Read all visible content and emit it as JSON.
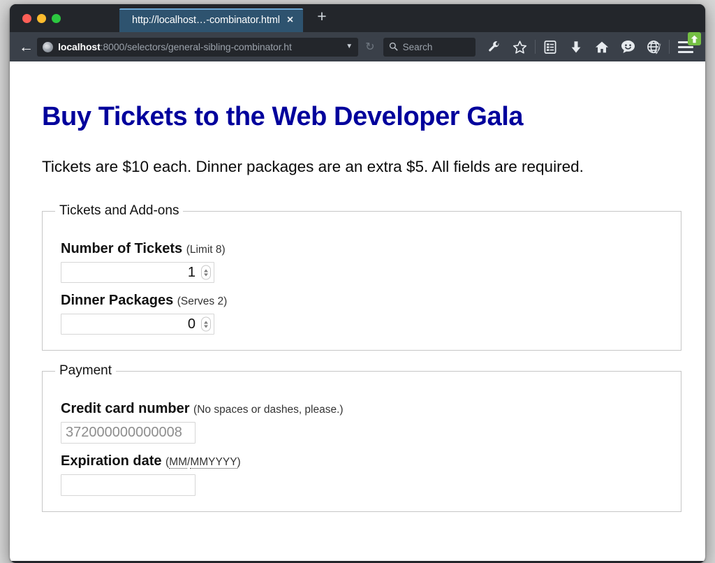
{
  "browser": {
    "traffic_lights": [
      {
        "name": "close",
        "color": "#ff5f57"
      },
      {
        "name": "minimize",
        "color": "#febc2e"
      },
      {
        "name": "zoom",
        "color": "#2cc840"
      }
    ],
    "tab": {
      "title": "http://localhost…-combinator.html",
      "close_label": "×"
    },
    "new_tab_label": "+",
    "nav": {
      "back_label": "←",
      "url_host": "localhost",
      "url_rest": ":8000/selectors/general-sibling-combinator.ht",
      "url_caret": "▼",
      "reload_label": "↻"
    },
    "search": {
      "placeholder": "Search",
      "glyph": "search-icon"
    },
    "toolbar_icons": [
      "wrench-icon",
      "star-icon",
      "reader-list-icon",
      "download-arrow-icon",
      "home-icon",
      "feedback-smiley-icon",
      "globe-pencil-icon",
      "hamburger-menu-icon"
    ],
    "update_badge": "update-available-arrow-icon"
  },
  "page": {
    "title": "Buy Tickets to the Web Developer Gala",
    "title_color": "#00009c",
    "intro": "Tickets are $10 each. Dinner packages are an extra $5. All fields are required.",
    "fieldsets": [
      {
        "legend": "Tickets and Add-ons",
        "fields": [
          {
            "label": "Number of Tickets",
            "hint": "(Limit 8)",
            "type": "number",
            "value": "1",
            "name": "number-of-tickets"
          },
          {
            "label": "Dinner Packages",
            "hint": "(Serves 2)",
            "type": "number",
            "value": "0",
            "name": "dinner-packages"
          }
        ]
      },
      {
        "legend": "Payment",
        "fields": [
          {
            "label": "Credit card number",
            "hint": "(No spaces or dashes, please.)",
            "type": "text",
            "placeholder": "372000000000008",
            "value": "",
            "name": "credit-card-number"
          },
          {
            "label": "Expiration date",
            "hint_parts": [
              "(",
              "MM",
              "/",
              "MMYYYY",
              ")"
            ],
            "hint": "(MM/MMYYYY)",
            "type": "text",
            "placeholder": "",
            "value": "",
            "name": "expiration-date"
          }
        ]
      }
    ]
  }
}
